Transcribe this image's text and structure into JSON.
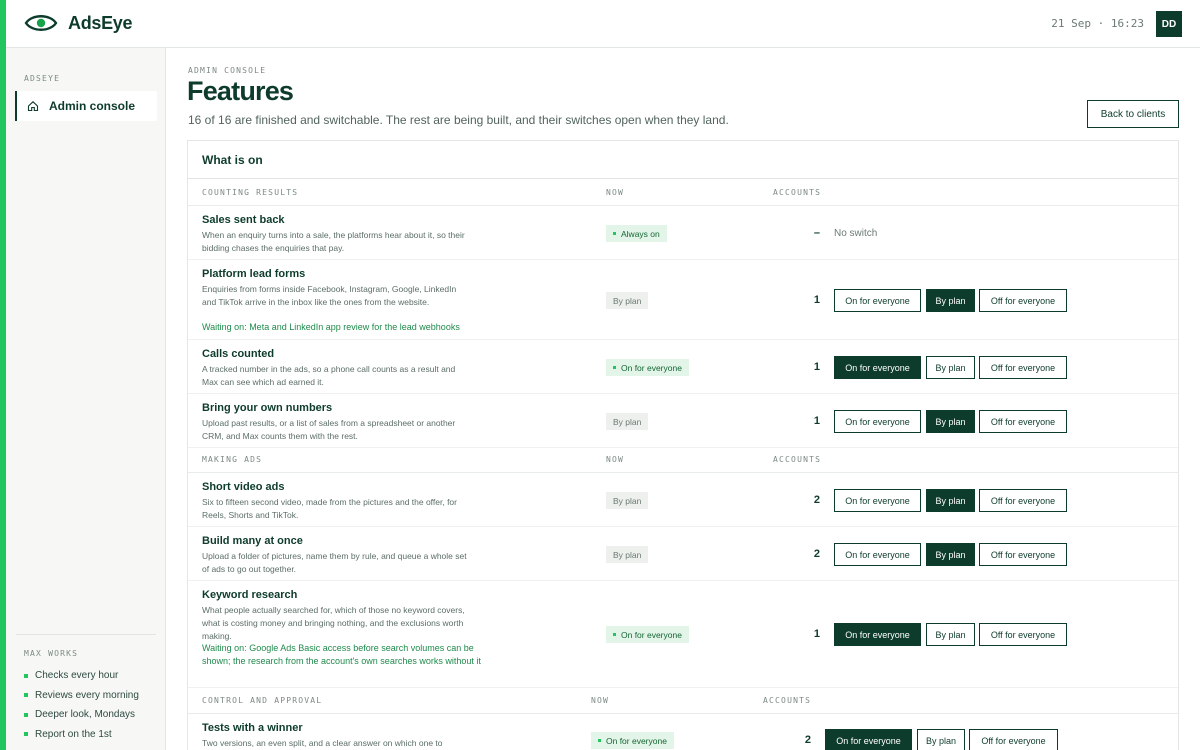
{
  "app": {
    "name": "AdsEye",
    "time": "21 Sep · 16:23",
    "avatar": "DD",
    "accent": "#22c55e",
    "brand": "#0d3b2c"
  },
  "sidebar": {
    "section": "ADSEYE",
    "items": [
      {
        "label": "Admin console",
        "icon": "home-icon"
      }
    ],
    "max_title": "MAX WORKS",
    "max_items": [
      "Checks every hour",
      "Reviews every morning",
      "Deeper look, Mondays",
      "Report on the 1st"
    ]
  },
  "header": {
    "crumb": "ADMIN CONSOLE",
    "title": "Features",
    "subtitle": "16 of 16 are finished and switchable. The rest are being built, and their switches open when they land.",
    "back": "Back to clients"
  },
  "card": {
    "title": "What is on",
    "sections": [
      {
        "name": "COUNTING RESULTS",
        "col_now": "NOW",
        "col_accounts": "ACCOUNTS",
        "rows": [
          {
            "title": "Sales sent back",
            "desc": "When an enquiry turns into a sale, the platforms hear about it, so their bidding chases the enquiries that pay.",
            "now": "Always on",
            "accounts": "–",
            "no_switch": "No switch"
          },
          {
            "title": "Platform lead forms",
            "desc": "Enquiries from forms inside Facebook, Instagram, Google, LinkedIn and TikTok arrive in the inbox like the ones from the website.",
            "waiting": "Waiting on: Meta and LinkedIn app review for the lead webhooks",
            "now": "By plan",
            "accounts": "1",
            "mode": "By plan"
          },
          {
            "title": "Calls counted",
            "desc": "A tracked number in the ads, so a phone call counts as a result and Max can see which ad earned it.",
            "now": "On for everyone",
            "accounts": "1",
            "mode": "On for everyone"
          },
          {
            "title": "Bring your own numbers",
            "desc": "Upload past results, or a list of sales from a spreadsheet or another CRM, and Max counts them with the rest.",
            "now": "By plan",
            "accounts": "1",
            "mode": "By plan"
          }
        ]
      },
      {
        "name": "MAKING ADS",
        "col_now": "NOW",
        "col_accounts": "ACCOUNTS",
        "rows": [
          {
            "title": "Short video ads",
            "desc": "Six to fifteen second video, made from the pictures and the offer, for Reels, Shorts and TikTok.",
            "now": "By plan",
            "accounts": "2",
            "mode": "By plan"
          },
          {
            "title": "Build many at once",
            "desc": "Upload a folder of pictures, name them by rule, and queue a whole set of ads to go out together.",
            "now": "By plan",
            "accounts": "2",
            "mode": "By plan"
          },
          {
            "title": "Keyword research",
            "desc": "What people actually searched for, which of those no keyword covers, what is costing money and bringing nothing, and the exclusions worth making.",
            "waiting": "Waiting on: Google Ads Basic access before search volumes can be shown; the research from the account's own searches works without it",
            "now": "On for everyone",
            "accounts": "1",
            "mode": "On for everyone"
          }
        ]
      },
      {
        "name": "CONTROL AND APPROVAL",
        "col_now": "NOW",
        "col_accounts": "ACCOUNTS",
        "rows": [
          {
            "title": "Tests with a winner",
            "desc": "Two versions, an even split, and a clear answer on which one to",
            "now": "On for everyone",
            "accounts": "2",
            "mode": "On for everyone"
          }
        ]
      }
    ]
  },
  "switch_labels": {
    "on": "On for everyone",
    "plan": "By plan",
    "off": "Off for everyone"
  }
}
